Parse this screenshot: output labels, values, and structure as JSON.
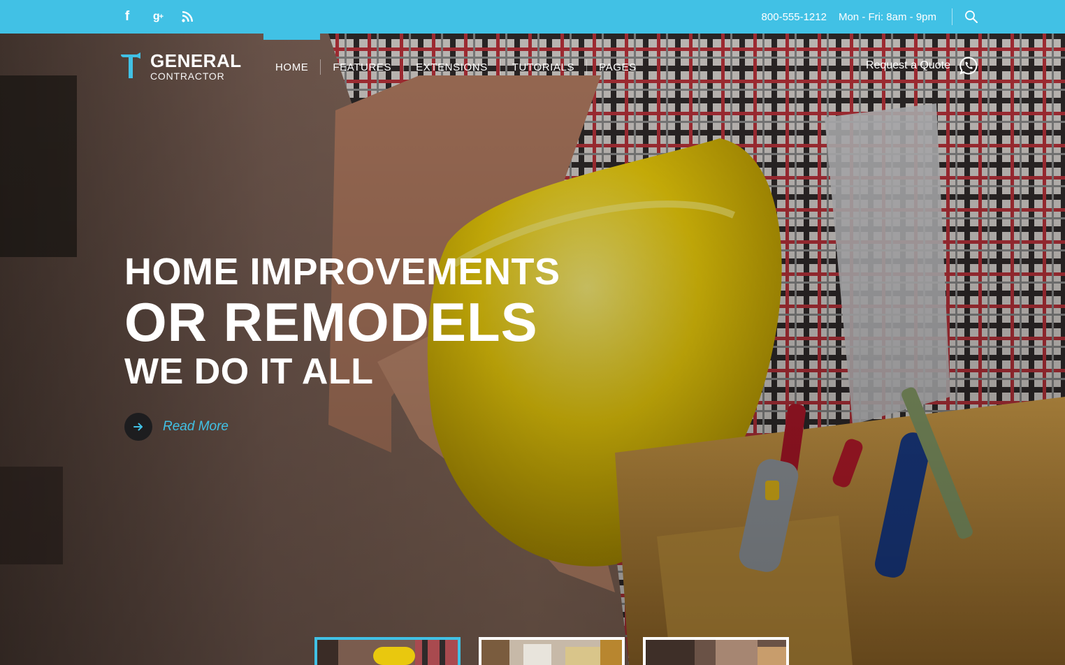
{
  "topbar": {
    "social": [
      {
        "name": "facebook-icon",
        "glyph": "f"
      },
      {
        "name": "google-plus-icon",
        "glyph": "g",
        "sup": "+"
      },
      {
        "name": "rss-icon"
      }
    ],
    "phone": "800-555-1212",
    "hours": "Mon - Fri: 8am - 9pm",
    "search_icon": "search-icon"
  },
  "logo": {
    "title": "GENERAL",
    "subtitle": "CONTRACTOR",
    "icon": "hammer-icon"
  },
  "nav": {
    "items": [
      {
        "label": "HOME",
        "active": true
      },
      {
        "label": "FEATURES"
      },
      {
        "label": "EXTENSIONS"
      },
      {
        "label": "TUTORIALS"
      },
      {
        "label": "PAGES"
      }
    ]
  },
  "quote": {
    "label": "Request a Quote",
    "icon": "whatsapp-icon"
  },
  "hero": {
    "line1": "HOME IMPROVEMENTS",
    "line2": "OR REMODELS",
    "line3": "WE DO IT ALL",
    "read_more": "Read More",
    "read_more_icon": "arrow-right-icon"
  },
  "thumbnails": {
    "count": 3,
    "active_index": 0
  },
  "colors": {
    "accent": "#41c1e5",
    "dark": "#1d1d1f",
    "text": "#ffffff"
  }
}
